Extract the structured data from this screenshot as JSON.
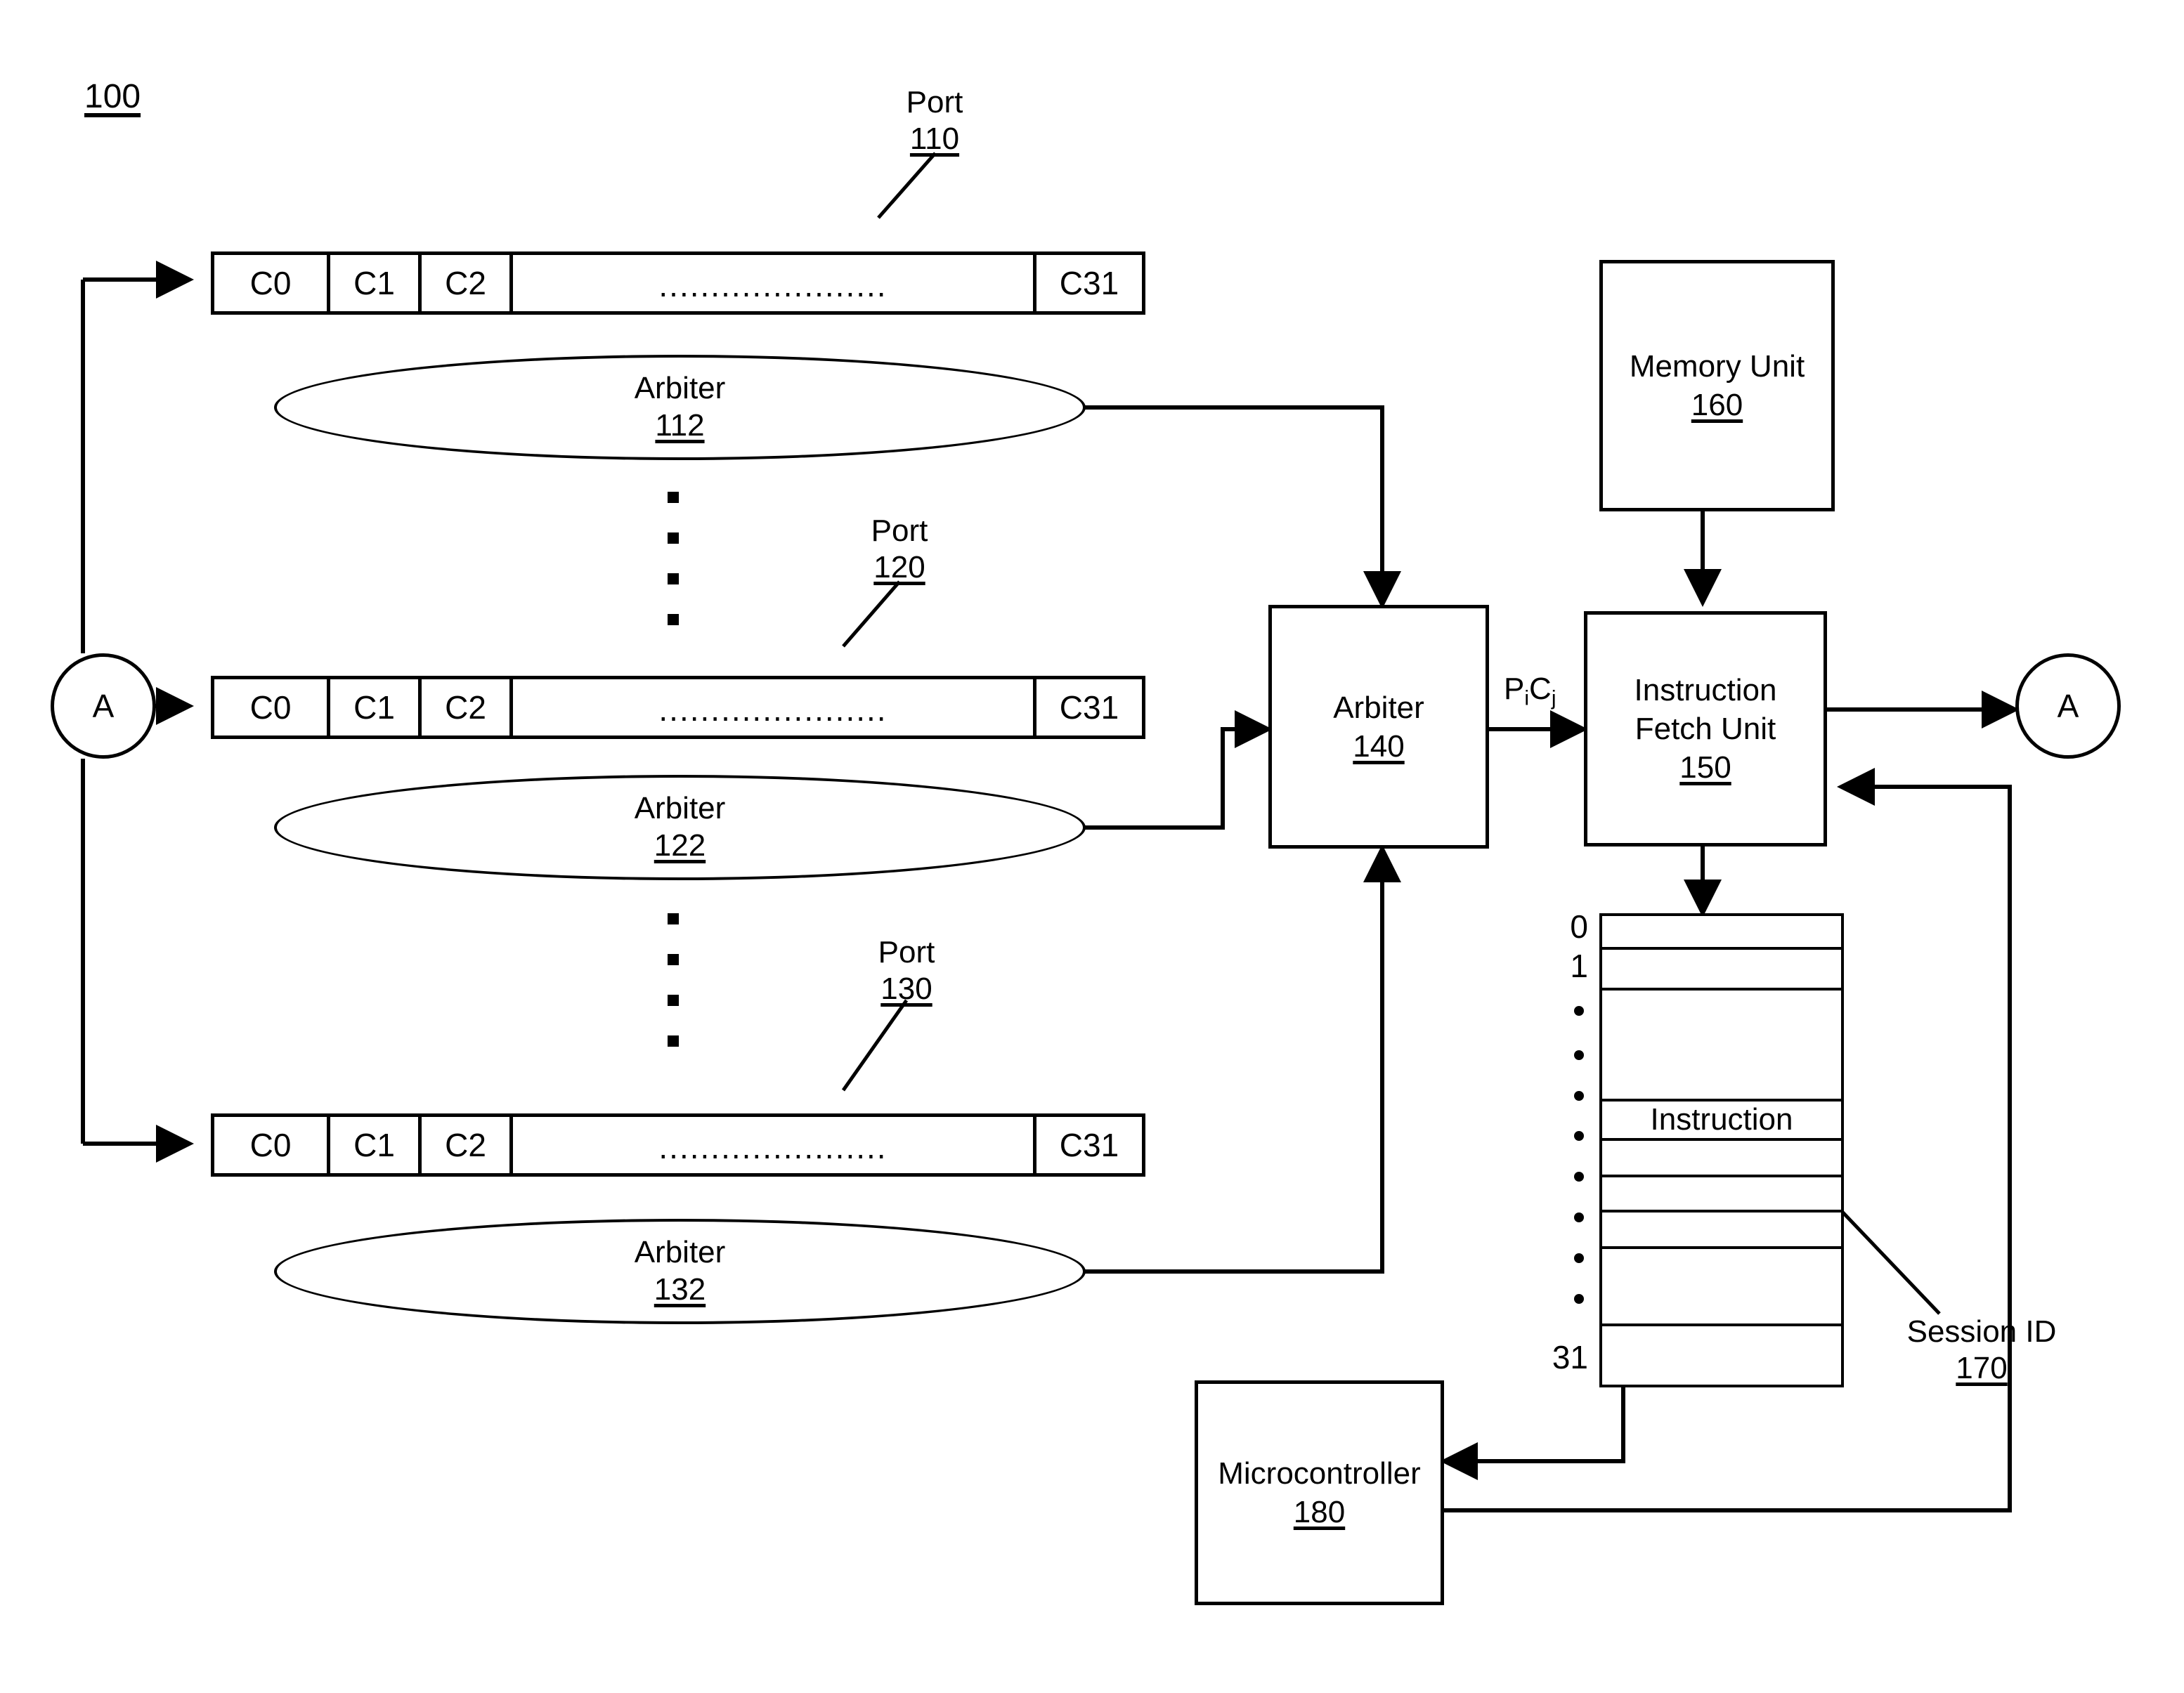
{
  "figure": {
    "number": "100"
  },
  "ports": [
    {
      "label": "Port",
      "ref": "110",
      "cells": [
        "C0",
        "C1",
        "C2"
      ],
      "ellipsis": "......................",
      "last_cell": "C31",
      "arbiter": {
        "label": "Arbiter",
        "ref": "112"
      }
    },
    {
      "label": "Port",
      "ref": "120",
      "cells": [
        "C0",
        "C1",
        "C2"
      ],
      "ellipsis": "......................",
      "last_cell": "C31",
      "arbiter": {
        "label": "Arbiter",
        "ref": "122"
      }
    },
    {
      "label": "Port",
      "ref": "130",
      "cells": [
        "C0",
        "C1",
        "C2"
      ],
      "ellipsis": "......................",
      "last_cell": "C31",
      "arbiter": {
        "label": "Arbiter",
        "ref": "132"
      }
    }
  ],
  "connectors": {
    "left_label": "A",
    "right_label": "A"
  },
  "arbiter_main": {
    "label": "Arbiter",
    "ref": "140"
  },
  "signal": {
    "prefix": "P",
    "sub1": "i",
    "mid": "C",
    "sub2": "j"
  },
  "memory_unit": {
    "label": "Memory Unit",
    "ref": "160"
  },
  "instruction_fetch_unit": {
    "line1": "Instruction",
    "line2": "Fetch Unit",
    "ref": "150"
  },
  "microcontroller": {
    "label": "Microcontroller",
    "ref": "180"
  },
  "session": {
    "label": "Session ID",
    "ref": "170",
    "row_first": "0",
    "row_second": "1",
    "row_last": "31",
    "instruction_label": "Instruction"
  }
}
